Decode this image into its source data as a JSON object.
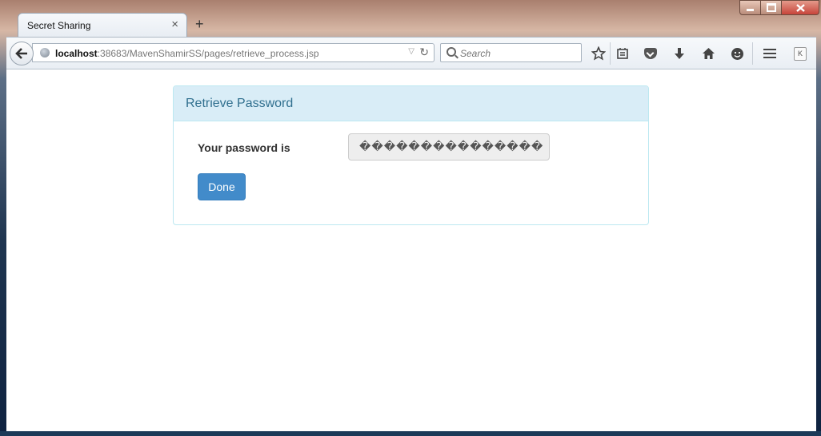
{
  "browser": {
    "tab_title": "Secret Sharing",
    "tab_close": "×",
    "new_tab": "+",
    "url_host": "localhost",
    "url_rest": ":38683/MavenShamirSS/pages/retrieve_process.jsp",
    "search_placeholder": "Search",
    "icons": [
      "back-arrow-icon",
      "globe-icon",
      "dropdown-icon",
      "reload-icon",
      "search-icon",
      "star-icon",
      "reading-list-icon",
      "pocket-icon",
      "download-icon",
      "home-icon",
      "chat-icon",
      "menu-icon",
      "k-extension-icon"
    ]
  },
  "panel": {
    "title": "Retrieve Password",
    "password_label": "Your password is",
    "password_value": "���������������",
    "done_label": "Done"
  },
  "colors": {
    "panel_heading_bg": "#d9edf7",
    "panel_title": "#31708f",
    "button_primary": "#428bca"
  }
}
